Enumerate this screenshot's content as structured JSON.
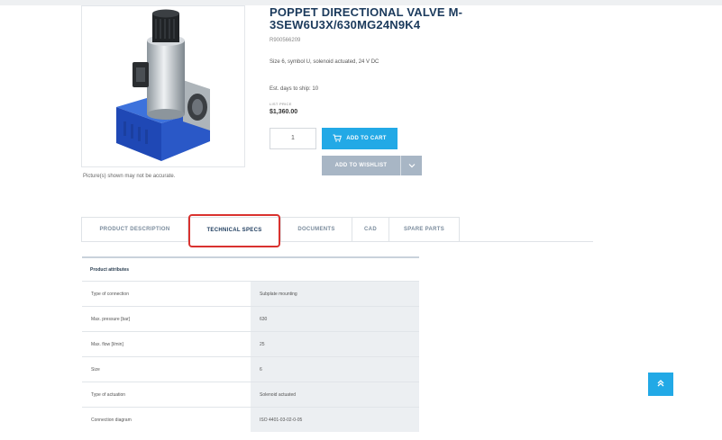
{
  "product": {
    "title": "POPPET DIRECTIONAL VALVE M-3SEW6U3X/630MG24N9K4",
    "part_number": "R900566209",
    "description": "Size 6, symbol U, solenoid actuated, 24 V DC",
    "shipping": "Est. days to ship: 10",
    "price_label": "LIST PRICE",
    "price": "$1,360.00",
    "image_caption": "Picture(s) shown may not be accurate."
  },
  "actions": {
    "quantity": "1",
    "add_to_cart": "ADD TO CART",
    "add_to_wishlist": "ADD TO WISHLIST"
  },
  "tabs": [
    {
      "label": "PRODUCT DESCRIPTION",
      "active": false
    },
    {
      "label": "TECHNICAL SPECS",
      "active": true
    },
    {
      "label": "DOCUMENTS",
      "active": false
    },
    {
      "label": "CAD",
      "active": false
    },
    {
      "label": "SPARE PARTS",
      "active": false
    }
  ],
  "specs": {
    "heading": "Product attributes",
    "rows": [
      {
        "name": "Type of connection",
        "value": "Subplate mounting"
      },
      {
        "name": "Max. pressure [bar]",
        "value": "630"
      },
      {
        "name": "Max. flow [l/min]",
        "value": "25"
      },
      {
        "name": "Size",
        "value": "6"
      },
      {
        "name": "Type of actuation",
        "value": "Solenoid actuated"
      },
      {
        "name": "Connection diagram",
        "value": "ISO 4401-03-02-0-05"
      }
    ]
  },
  "icons": {
    "cart": "cart-icon",
    "dropdown": "chevron-down-icon",
    "back_to_top": "chevron-up-icon"
  },
  "colors": {
    "accent": "#22a9e6",
    "title": "#1b3a5c",
    "wishlist": "#a8b6c5",
    "highlight": "#d9322f"
  }
}
